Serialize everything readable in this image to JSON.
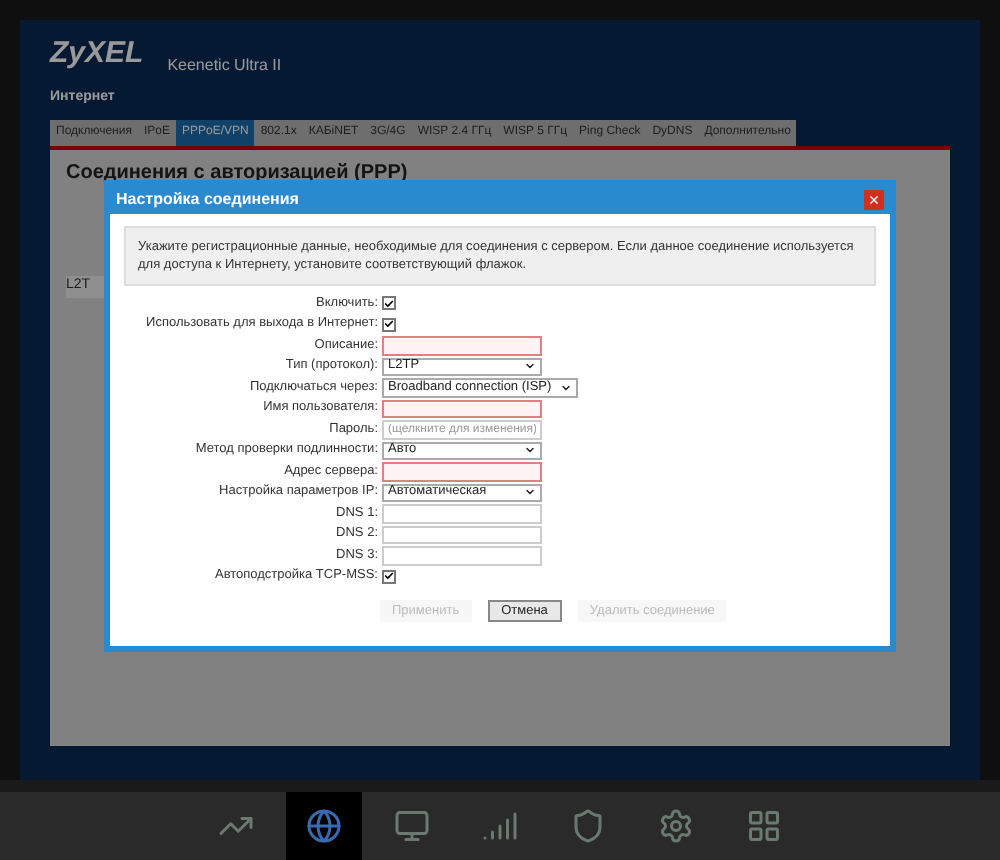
{
  "header": {
    "logo": "ZyXEL",
    "model": "Keenetic Ultra II",
    "section": "Интернет"
  },
  "tabs": [
    {
      "label": "Подключения",
      "selected": false
    },
    {
      "label": "IPoE",
      "selected": false
    },
    {
      "label": "PPPoE/VPN",
      "selected": true
    },
    {
      "label": "802.1x",
      "selected": false
    },
    {
      "label": "КАБiNET",
      "selected": false
    },
    {
      "label": "3G/4G",
      "selected": false
    },
    {
      "label": "WISP 2.4 ГГц",
      "selected": false
    },
    {
      "label": "WISP 5 ГГц",
      "selected": false
    },
    {
      "label": "Ping Check",
      "selected": false
    },
    {
      "label": "DyDNS",
      "selected": false
    },
    {
      "label": "Дополнительно",
      "selected": false
    }
  ],
  "panel": {
    "title": "Соединения с авторизацией (PPP)",
    "cell": "L2T"
  },
  "dialog": {
    "title": "Настройка соединения",
    "close": "×",
    "hint": "Укажите регистрационные данные, необходимые для соединения с сервером. Если данное соединение используется для доступа к Интернету, установите соответствующий флажок.",
    "fields": [
      {
        "kind": "checkbox",
        "label": "Включить:",
        "checked": true
      },
      {
        "kind": "checkbox",
        "label": "Использовать для выхода в Интернет:",
        "checked": true
      },
      {
        "kind": "text",
        "label": "Описание:",
        "required": true
      },
      {
        "kind": "select",
        "label": "Тип (протокол):",
        "value": "L2TP"
      },
      {
        "kind": "select",
        "label": "Подключаться через:",
        "value": "Broadband connection (ISP)",
        "wide": true
      },
      {
        "kind": "text",
        "label": "Имя пользователя:",
        "required": true
      },
      {
        "kind": "text",
        "label": "Пароль:",
        "placeholder": "(щелкните для изменения)",
        "required": false
      },
      {
        "kind": "select",
        "label": "Метод проверки подлинности:",
        "value": "Авто"
      },
      {
        "kind": "text",
        "label": "Адрес сервера:",
        "required": true
      },
      {
        "kind": "select",
        "label": "Настройка параметров IP:",
        "value": "Автоматическая"
      },
      {
        "kind": "text",
        "label": "DNS 1:",
        "required": false
      },
      {
        "kind": "text",
        "label": "DNS 2:",
        "required": false
      },
      {
        "kind": "text",
        "label": "DNS 3:",
        "required": false
      },
      {
        "kind": "checkbox",
        "label": "Автоподстройка TCP-MSS:",
        "checked": true
      }
    ],
    "buttons": [
      {
        "label": "Применить",
        "disabled": true
      },
      {
        "label": "Отмена",
        "disabled": false
      },
      {
        "label": "Удалить соединение",
        "disabled": true
      }
    ]
  },
  "taskbar": [
    {
      "kind": "chart",
      "selected": false
    },
    {
      "kind": "globe",
      "selected": true
    },
    {
      "kind": "network",
      "selected": false
    },
    {
      "kind": "signal",
      "selected": false
    },
    {
      "kind": "shield",
      "selected": false
    },
    {
      "kind": "gear",
      "selected": false
    },
    {
      "kind": "grid",
      "selected": false
    }
  ]
}
